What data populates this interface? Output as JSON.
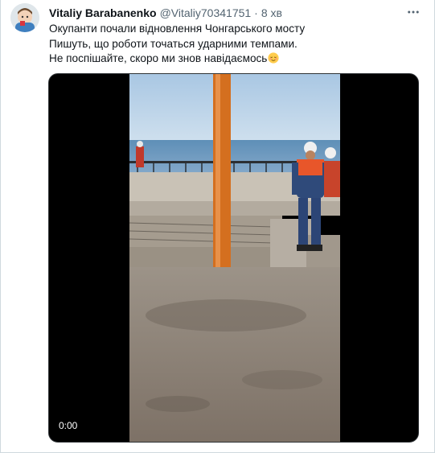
{
  "tweet": {
    "author": {
      "display_name": "Vitaliy Barabanenko",
      "handle": "@Vitaliy70341751"
    },
    "separator": "·",
    "timestamp": "8 хв",
    "text_lines": [
      "Окупанти почали відновлення Чонгарського мосту",
      "Пишуть, що роботи точаться ударними темпами.",
      "Не поспішайте, скоро ми знов навідаємось"
    ],
    "emoji": "relieved-face-emoji",
    "media": {
      "type": "video",
      "time": "0:00"
    },
    "icons": {
      "more": "more-horizontal-icon"
    }
  }
}
